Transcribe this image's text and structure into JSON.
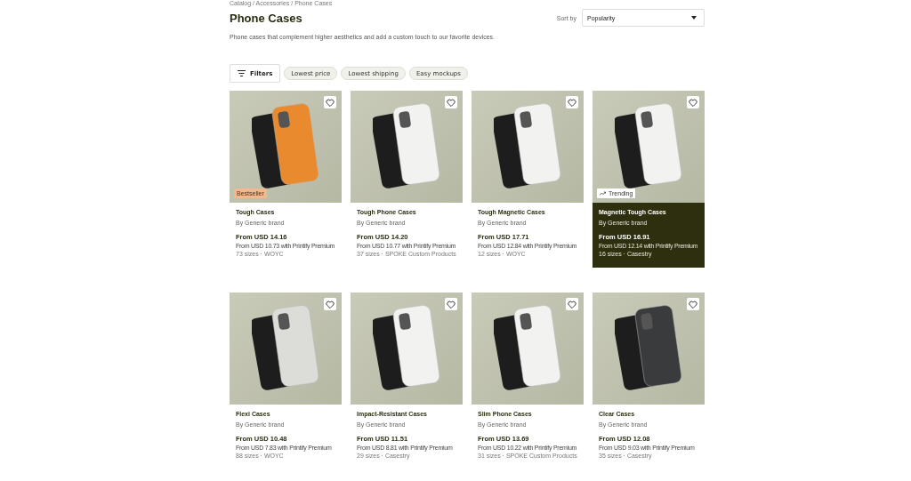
{
  "breadcrumb": "Catalog / Accessories / Phone Cases",
  "title": "Phone Cases",
  "sort": {
    "label": "Sort by",
    "value": "Popularity"
  },
  "description": "Phone cases that complement higher aesthetics and add a custom touch to our favorite devices.",
  "filters": {
    "button": "Filters",
    "chips": [
      "Lowest price",
      "Lowest shipping",
      "Easy mockups"
    ]
  },
  "products": [
    {
      "name": "Tough Cases",
      "brand": "By Generic brand",
      "price": "From USD 14.16",
      "premium": "From USD 10.73 with Printify Premium",
      "meta": "73 sizes · WOYC",
      "badge": {
        "kind": "bestseller",
        "text": "Bestseller"
      },
      "highlighted": false
    },
    {
      "name": "Tough Phone Cases",
      "brand": "By Generic brand",
      "price": "From USD 14.20",
      "premium": "From USD 10.77 with Printify Premium",
      "meta": "37 sizes · SPOKE Custom Products",
      "highlighted": false
    },
    {
      "name": "Tough Magnetic Cases",
      "brand": "By Generic brand",
      "price": "From USD 17.71",
      "premium": "From USD 12.84 with Printify Premium",
      "meta": "12 sizes · WOYC",
      "highlighted": false
    },
    {
      "name": "Magnetic Tough Cases",
      "brand": "By Generic brand",
      "price": "From USD 16.91",
      "premium": "From USD 12.14 with Printify Premium",
      "meta": "16 sizes · Casestry",
      "badge": {
        "kind": "trending",
        "text": "Trending"
      },
      "highlighted": true
    },
    {
      "name": "Flexi Cases",
      "brand": "By Generic brand",
      "price": "From USD 10.48",
      "premium": "From USD 7.83 with Printify Premium",
      "meta": "88 sizes · WOYC",
      "highlighted": false
    },
    {
      "name": "Impact-Resistant Cases",
      "brand": "By Generic brand",
      "price": "From USD 11.51",
      "premium": "From USD 8.81 with Printify Premium",
      "meta": "29 sizes · Casestry",
      "highlighted": false
    },
    {
      "name": "Slim Phone Cases",
      "brand": "By Generic brand",
      "price": "From USD 13.69",
      "premium": "From USD 10.22 with Printify Premium",
      "meta": "31 sizes · SPOKE Custom Products",
      "highlighted": false
    },
    {
      "name": "Clear Cases",
      "brand": "By Generic brand",
      "price": "From USD 12.08",
      "premium": "From USD 9.03 with Printify Premium",
      "meta": "35 sizes · Casestry",
      "highlighted": false
    }
  ]
}
